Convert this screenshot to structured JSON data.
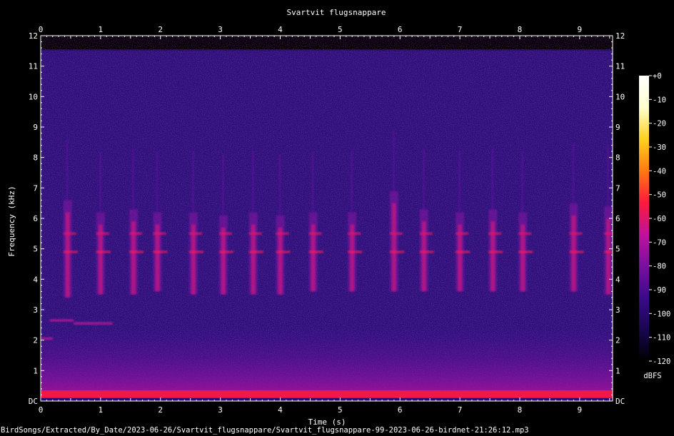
{
  "chart_data": {
    "type": "heatmap",
    "title": "Svartvit flugsnappare",
    "xlabel": "Time (s)",
    "ylabel": "Frequency (kHz)",
    "xlim": [
      0,
      9.55
    ],
    "ylim": [
      0,
      12
    ],
    "x_ticks": [
      "0",
      "1",
      "2",
      "3",
      "4",
      "5",
      "6",
      "7",
      "8",
      "9"
    ],
    "y_ticks": [
      "DC",
      "1",
      "2",
      "3",
      "4",
      "5",
      "6",
      "7",
      "8",
      "9",
      "10",
      "11",
      "12"
    ],
    "colorbar": {
      "label": "dBFS",
      "range": [
        -120,
        0
      ],
      "ticks": [
        "+0",
        "-10",
        "-20",
        "-30",
        "-40",
        "-50",
        "-60",
        "-70",
        "-80",
        "-90",
        "-100",
        "-110",
        "-120"
      ],
      "colors": [
        "#000000",
        "#1a0650",
        "#3a0a8c",
        "#7a0fa0",
        "#c0129a",
        "#ff1a3c",
        "#ff7a12",
        "#ffd21e",
        "#ffffd0",
        "#ffffff"
      ]
    },
    "background_color": "#2a1078",
    "song_elements": [
      {
        "t": 0.45,
        "f_low": 3.4,
        "f_high": 6.6
      },
      {
        "t": 1.0,
        "f_low": 3.5,
        "f_high": 6.2
      },
      {
        "t": 1.55,
        "f_low": 3.5,
        "f_high": 6.3
      },
      {
        "t": 1.95,
        "f_low": 3.6,
        "f_high": 6.2
      },
      {
        "t": 2.55,
        "f_low": 3.5,
        "f_high": 6.2
      },
      {
        "t": 3.05,
        "f_low": 3.5,
        "f_high": 6.1
      },
      {
        "t": 3.55,
        "f_low": 3.5,
        "f_high": 6.2
      },
      {
        "t": 4.0,
        "f_low": 3.5,
        "f_high": 6.1
      },
      {
        "t": 4.55,
        "f_low": 3.6,
        "f_high": 6.2
      },
      {
        "t": 5.2,
        "f_low": 3.6,
        "f_high": 6.2
      },
      {
        "t": 5.9,
        "f_low": 3.6,
        "f_high": 6.9
      },
      {
        "t": 6.4,
        "f_low": 3.6,
        "f_high": 6.3
      },
      {
        "t": 7.0,
        "f_low": 3.6,
        "f_high": 6.2
      },
      {
        "t": 7.55,
        "f_low": 3.6,
        "f_high": 6.3
      },
      {
        "t": 8.05,
        "f_low": 3.6,
        "f_high": 6.2
      },
      {
        "t": 8.9,
        "f_low": 3.6,
        "f_high": 6.5
      },
      {
        "t": 9.48,
        "f_low": 3.5,
        "f_high": 6.4
      }
    ],
    "low_tones": [
      {
        "t0": 0.15,
        "t1": 0.55,
        "f": 2.65
      },
      {
        "t0": 0.55,
        "t1": 1.2,
        "f": 2.55
      },
      {
        "t0": 0.0,
        "t1": 0.2,
        "f": 2.05
      }
    ],
    "noise_band": {
      "f_low": 0.0,
      "f_high": 1.2
    }
  },
  "footer_path": "BirdSongs/Extracted/By_Date/2023-06-26/Svartvit_flugsnappare/Svartvit_flugsnappare-99-2023-06-26-birdnet-21:26:12.mp3"
}
